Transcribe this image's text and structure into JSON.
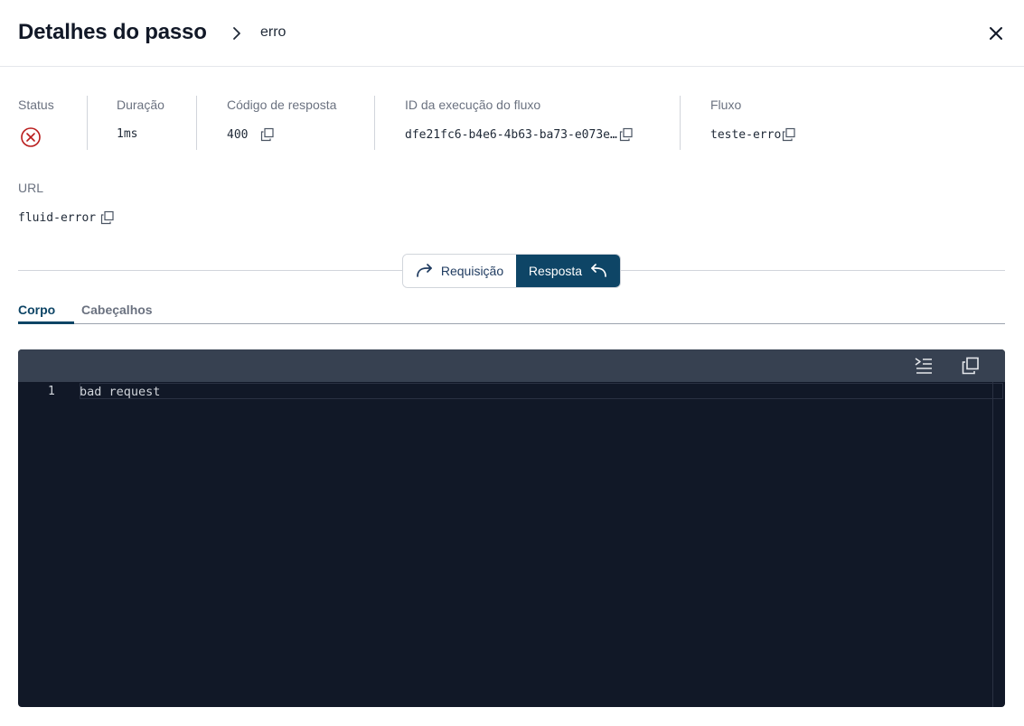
{
  "header": {
    "title": "Detalhes do passo",
    "breadcrumb_current": "erro"
  },
  "meta": {
    "status": {
      "label": "Status",
      "state": "error",
      "icon": "error-circle-icon"
    },
    "duration": {
      "label": "Duração",
      "value": "1ms"
    },
    "response_code": {
      "label": "Código de resposta",
      "value": "400"
    },
    "execution_id": {
      "label": "ID da execução do fluxo",
      "value": "dfe21fc6-b4e6-4b63-ba73-e073e…"
    },
    "flow": {
      "label": "Fluxo",
      "value": "teste-erro"
    },
    "url": {
      "label": "URL",
      "value": "fluid-error"
    }
  },
  "toggle": {
    "request_label": "Requisição",
    "response_label": "Resposta",
    "selected": "Resposta"
  },
  "tabs": [
    {
      "label": "Corpo",
      "active": true
    },
    {
      "label": "Cabeçalhos",
      "active": false
    }
  ],
  "editor": {
    "lines": [
      {
        "number": "1",
        "text": "bad request"
      }
    ]
  },
  "colors": {
    "primary": "#0e4566",
    "error": "#b91c1c",
    "editor_bg": "#111827",
    "toolbar_bg": "#374151"
  }
}
